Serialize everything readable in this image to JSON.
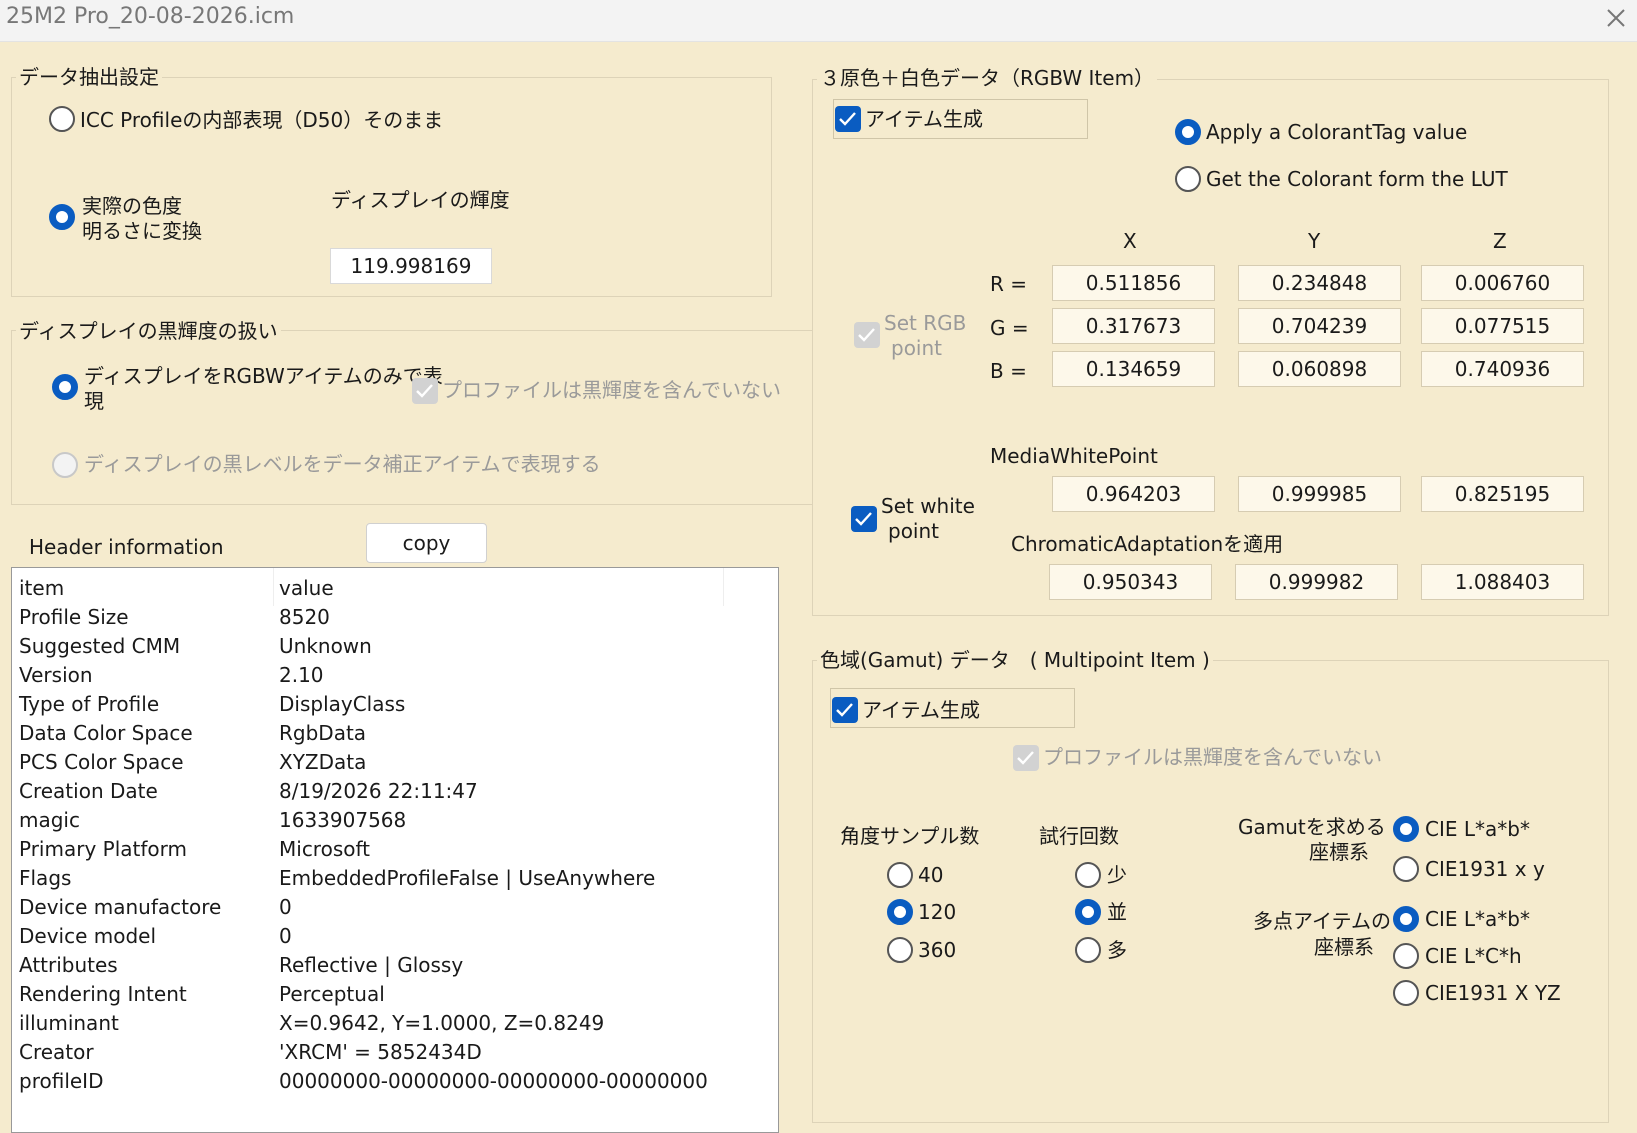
{
  "window": {
    "title": "25M2 Pro_20-08-2026.icm"
  },
  "extract": {
    "title": "データ抽出設定",
    "opt_internal": "ICC Profileの内部表現（D50）そのまま",
    "opt_convert_line1": "実際の色度",
    "opt_convert_line2": "明るさに変換",
    "lum_label": "ディスプレイの輝度",
    "lum_value": "119.998169"
  },
  "black": {
    "title": "ディスプレイの黒輝度の扱い",
    "opt_rgbw_line1": "ディスプレイをRGBWアイテムのみで表",
    "opt_rgbw_line2": "現",
    "no_black": "プロファイルは黒輝度を含んでいない",
    "opt_correction": "ディスプレイの黒レベルをデータ補正アイテムで表現する"
  },
  "header": {
    "label": "Header information",
    "copy": "copy",
    "col_item": "item",
    "col_value": "value",
    "rows": [
      {
        "item": "Profile Size",
        "value": "8520"
      },
      {
        "item": "Suggested CMM",
        "value": "Unknown"
      },
      {
        "item": "Version",
        "value": "2.10"
      },
      {
        "item": "Type of Profile",
        "value": "DisplayClass"
      },
      {
        "item": "Data Color Space",
        "value": "RgbData"
      },
      {
        "item": "PCS Color Space",
        "value": "XYZData"
      },
      {
        "item": "Creation Date",
        "value": "8/19/2026  22:11:47"
      },
      {
        "item": "magic",
        "value": "1633907568"
      },
      {
        "item": "Primary Platform",
        "value": "Microsoft"
      },
      {
        "item": "Flags",
        "value": "EmbeddedProfileFalse | UseAnywhere"
      },
      {
        "item": "Device manufactore",
        "value": "0"
      },
      {
        "item": "Device model",
        "value": "0"
      },
      {
        "item": "Attributes",
        "value": "Reflective | Glossy"
      },
      {
        "item": "Rendering Intent",
        "value": "Perceptual"
      },
      {
        "item": "illuminant",
        "value": "X=0.9642, Y=1.0000, Z=0.8249"
      },
      {
        "item": "Creator",
        "value": "'XRCM' = 5852434D"
      },
      {
        "item": "profileID",
        "value": "00000000-00000000-00000000-00000000"
      }
    ]
  },
  "rgbw": {
    "title": "３原色＋白色データ（RGBW Item）",
    "item_gen": "アイテム生成",
    "apply_colorant": "Apply a ColorantTag value",
    "get_colorant": "Get the Colorant form the LUT",
    "col_x": "X",
    "col_y": "Y",
    "col_z": "Z",
    "set_rgb_line1": "Set RGB",
    "set_rgb_line2": "point",
    "r_label": "R =",
    "g_label": "G =",
    "b_label": "B =",
    "r": [
      "0.511856",
      "0.234848",
      "0.006760"
    ],
    "g": [
      "0.317673",
      "0.704239",
      "0.077515"
    ],
    "b": [
      "0.134659",
      "0.060898",
      "0.740936"
    ],
    "mwp_label": "MediaWhitePoint",
    "mwp": [
      "0.964203",
      "0.999985",
      "0.825195"
    ],
    "set_white_line1": "Set white",
    "set_white_line2": "point",
    "chad_label": "ChromaticAdaptationを適用",
    "chad": [
      "0.950343",
      "0.999982",
      "1.088403"
    ]
  },
  "gamut": {
    "title": "色域(Gamut) データ　( Multipoint Item )",
    "item_gen": "アイテム生成",
    "no_black": "プロファイルは黒輝度を含んでいない",
    "angle_label": "角度サンプル数",
    "angles": [
      "40",
      "120",
      "360"
    ],
    "trial_label": "試行回数",
    "trials": [
      "少",
      "並",
      "多"
    ],
    "gamut_cs_line1": "Gamutを求める",
    "gamut_cs_line2": "座標系",
    "gamut_cs": [
      "CIE L*a*b*",
      "CIE1931 x y"
    ],
    "multi_cs_line1": "多点アイテムの",
    "multi_cs_line2": "座標系",
    "multi_cs": [
      "CIE L*a*b*",
      "CIE L*C*h",
      "CIE1931 X YZ"
    ]
  },
  "colors": {
    "accent": "#0a5cc1",
    "background": "#f5ebce"
  }
}
